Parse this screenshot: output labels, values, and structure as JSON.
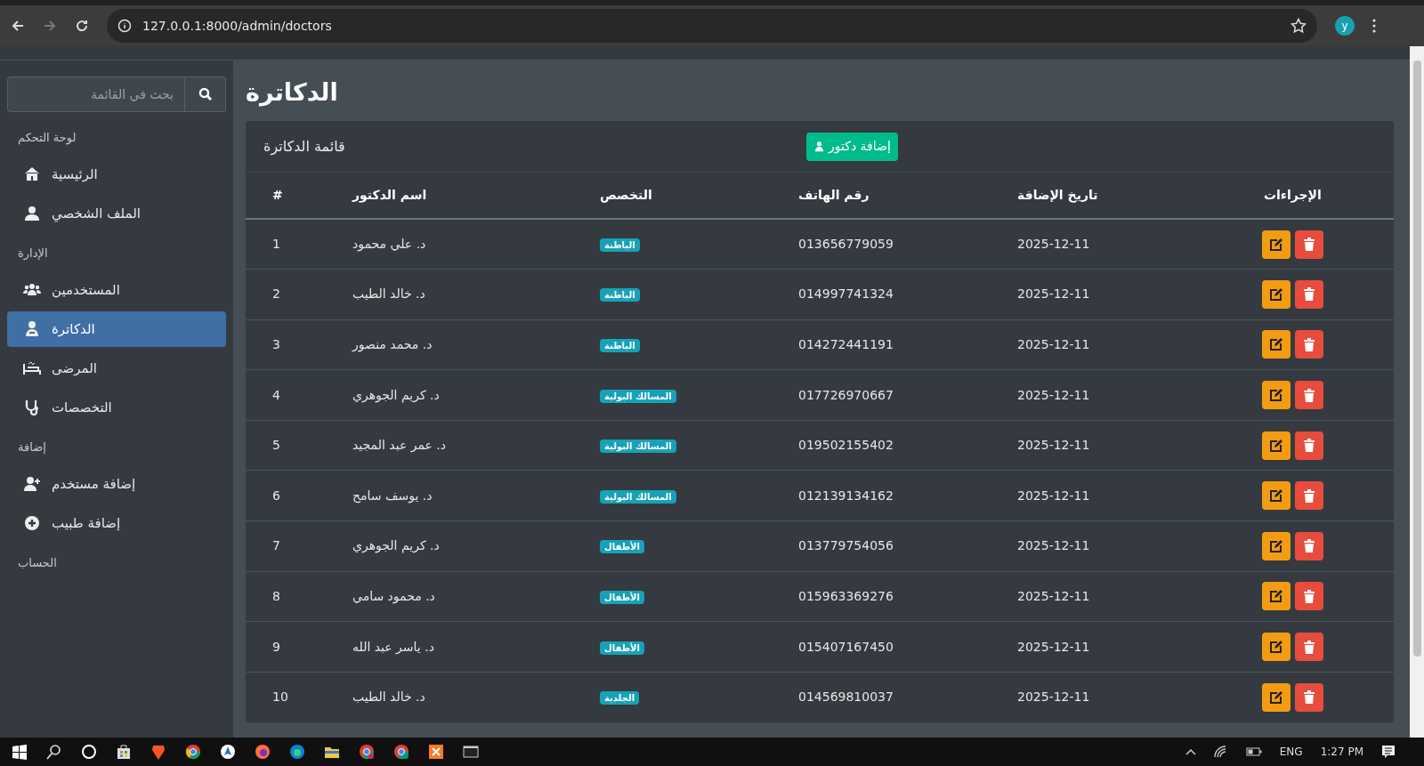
{
  "browser": {
    "url": "127.0.0.1:8000/admin/doctors",
    "profile_initial": "y"
  },
  "sidebar": {
    "search": {
      "placeholder": "بحث في القائمة"
    },
    "sections": [
      {
        "title": "لوحة التحكم",
        "items": [
          {
            "label": "الرئيسية",
            "selected": false
          },
          {
            "label": "الملف الشخصي",
            "selected": false
          }
        ]
      },
      {
        "title": "الإدارة",
        "items": [
          {
            "label": "المستخدمين",
            "selected": false
          },
          {
            "label": "الدكاترة",
            "selected": true
          },
          {
            "label": "المرضى",
            "selected": false
          },
          {
            "label": "التخصصات",
            "selected": false
          }
        ]
      },
      {
        "title": "إضافة",
        "items": [
          {
            "label": "إضافة مستخدم",
            "selected": false
          },
          {
            "label": "إضافة طبيب",
            "selected": false
          }
        ]
      },
      {
        "title": "الحساب"
      }
    ]
  },
  "page": {
    "title": "الدكاترة"
  },
  "card": {
    "title": "قائمة الدكاترة",
    "add_button": "إضافة دكتور"
  },
  "table": {
    "columns": [
      "الإجراءات",
      "تاريخ الإضافة",
      "رقم الهاتف",
      "التخصص",
      "اسم الدكتور",
      "#"
    ],
    "rows": [
      {
        "cells": [
          "",
          "2025-12-11",
          "013656779059",
          "الباطنة",
          "د. علي محمود",
          "1"
        ]
      },
      {
        "cells": [
          "",
          "2025-12-11",
          "014997741324",
          "الباطنة",
          "د. خالد الطيب",
          "2"
        ]
      },
      {
        "cells": [
          "",
          "2025-12-11",
          "014272441191",
          "الباطنة",
          "د. محمد منصور",
          "3"
        ]
      },
      {
        "cells": [
          "",
          "2025-12-11",
          "017726970667",
          "المسالك البولية",
          "د. كريم الجوهري",
          "4"
        ]
      },
      {
        "cells": [
          "",
          "2025-12-11",
          "019502155402",
          "المسالك البولية",
          "د. عمر عبد المجيد",
          "5"
        ]
      },
      {
        "cells": [
          "",
          "2025-12-11",
          "012139134162",
          "المسالك البولية",
          "د. يوسف سامح",
          "6"
        ]
      },
      {
        "cells": [
          "",
          "2025-12-11",
          "013779754056",
          "الأطفال",
          "د. كريم الجوهري",
          "7"
        ]
      },
      {
        "cells": [
          "",
          "2025-12-11",
          "015963369276",
          "الأطفال",
          "د. محمود سامي",
          "8"
        ]
      },
      {
        "cells": [
          "",
          "2025-12-11",
          "015407167450",
          "الأطفال",
          "د. ياسر عبد الله",
          "9"
        ]
      },
      {
        "cells": [
          "",
          "2025-12-11",
          "014569810037",
          "الجلدية",
          "د. خالد الطيب",
          "10"
        ]
      }
    ]
  },
  "taskbar": {
    "language": "ENG",
    "time": "1:27 PM"
  }
}
